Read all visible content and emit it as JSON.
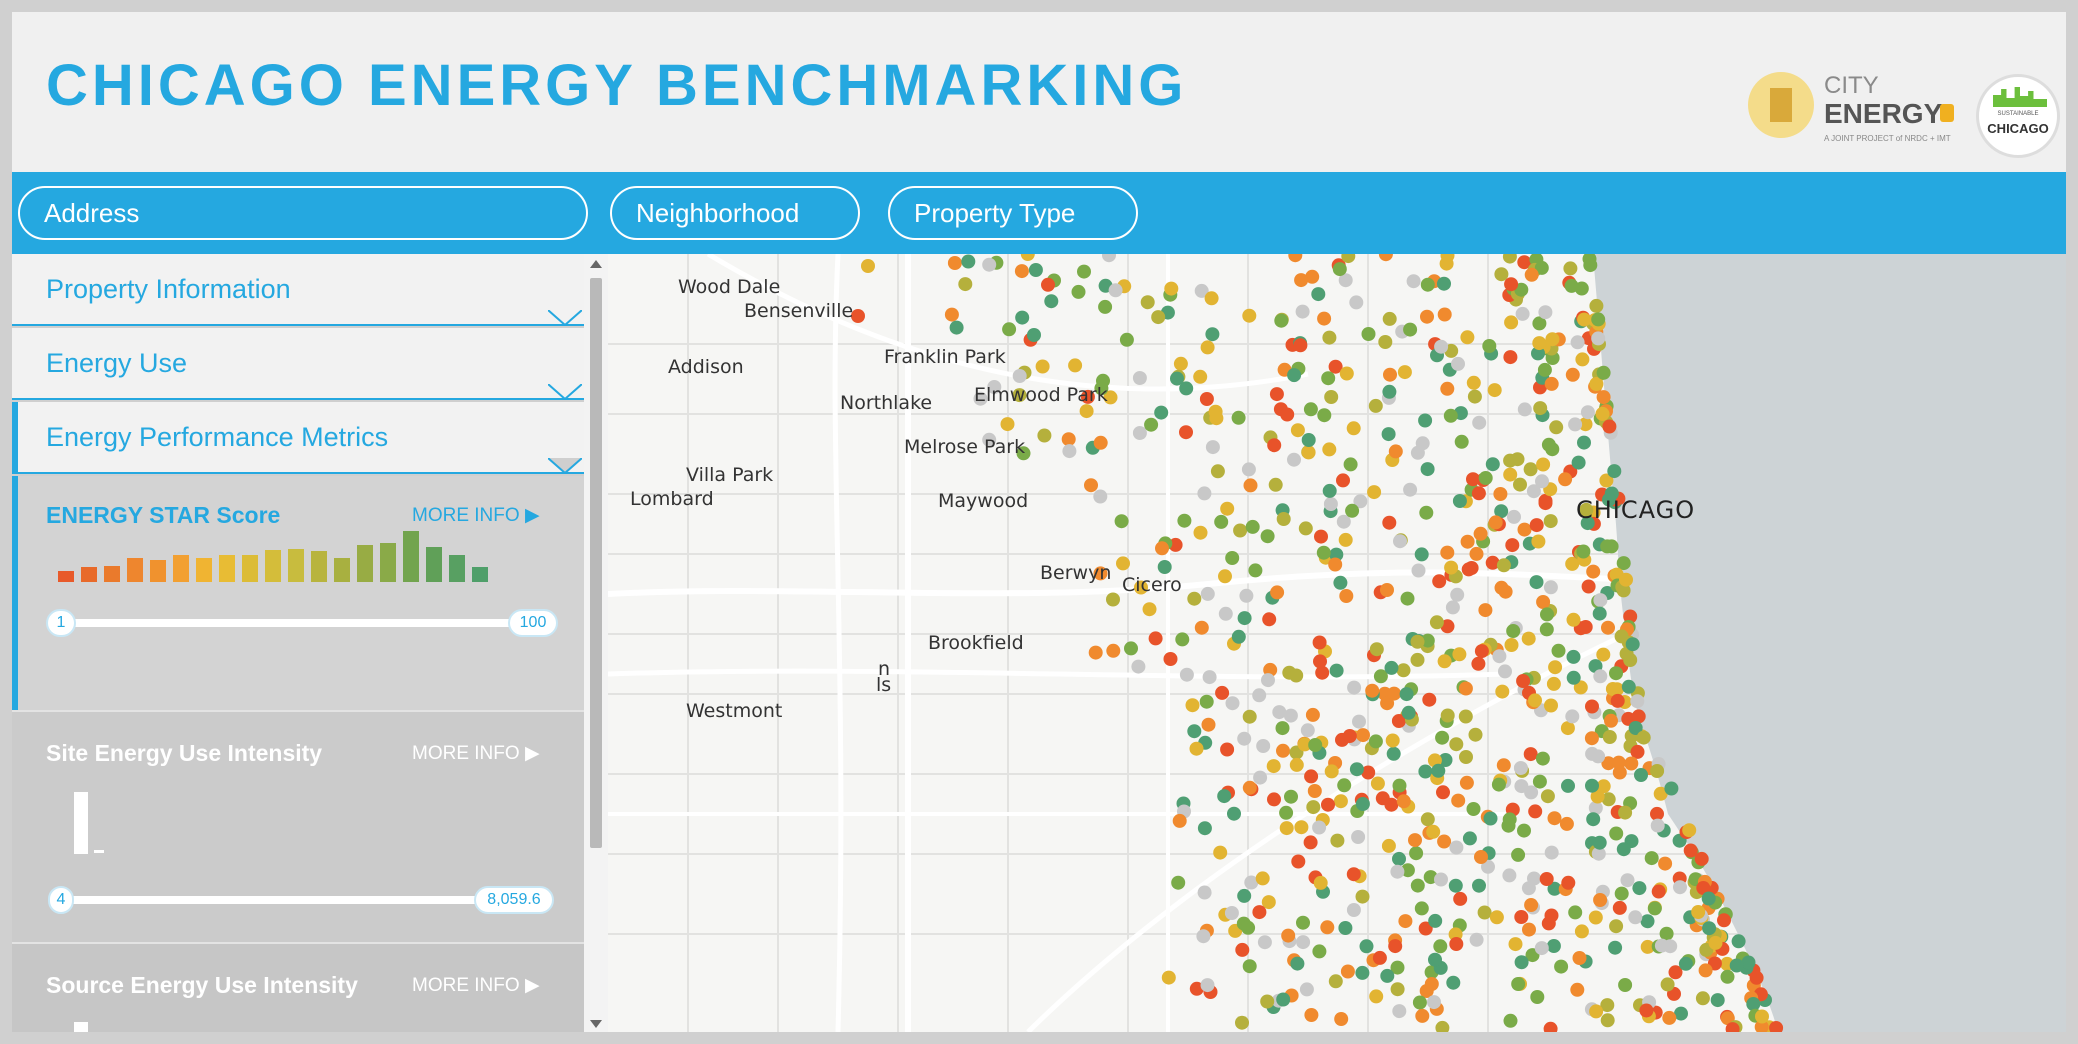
{
  "header": {
    "title": "CHICAGO ENERGY BENCHMARKING"
  },
  "logos": {
    "city_energy": {
      "line1": "CITY",
      "line2": "ENERGY",
      "sub": "A JOINT PROJECT of NRDC + IMT"
    },
    "sustainable_chicago": {
      "line1": "SUSTAINABLE",
      "line2": "CHICAGO"
    }
  },
  "nav": {
    "address": "Address",
    "neighborhood": "Neighborhood",
    "property_type": "Property Type"
  },
  "sidebar": {
    "sections": [
      "Property Information",
      "Energy Use",
      "Energy Performance Metrics"
    ],
    "more_info": "MORE INFO ▶",
    "energy_star": {
      "label": "ENERGY STAR Score",
      "min": "1",
      "max": "100",
      "histogram": [
        0.11,
        0.15,
        0.16,
        0.24,
        0.22,
        0.27,
        0.24,
        0.27,
        0.27,
        0.32,
        0.33,
        0.31,
        0.24,
        0.37,
        0.39,
        0.51,
        0.35,
        0.27,
        0.15
      ],
      "colors": [
        "#e85a2a",
        "#e86a2a",
        "#ea7a2c",
        "#ee862e",
        "#f0922e",
        "#f2a032",
        "#f0b432",
        "#e8bc34",
        "#dcbc36",
        "#d4bd3a",
        "#c8bc3e",
        "#b8b43e",
        "#a8b040",
        "#98ac44",
        "#8aaa48",
        "#72a44e",
        "#60a058",
        "#58a062",
        "#4f9f6a"
      ],
      "accent": "#25a8e0"
    },
    "site_eui": {
      "label": "Site Energy Use Intensity",
      "min": "4",
      "max": "8,059.6"
    },
    "source_eui": {
      "label": "Source Energy Use Intensity"
    }
  },
  "map": {
    "labels": {
      "wood_dale": "Wood Dale",
      "bensenville": "Bensenville",
      "addison": "Addison",
      "franklin_park": "Franklin Park",
      "northlake": "Northlake",
      "elmwood_park": "Elmwood Park",
      "melrose_park": "Melrose Park",
      "villa_park": "Villa Park",
      "lombard": "Lombard",
      "maywood": "Maywood",
      "chicago": "CHICAGO",
      "berwyn": "Berwyn",
      "cicero": "Cicero",
      "brookfield": "Brookfield",
      "westmont": "Westmont",
      "partial1": "n",
      "partial2": "ls"
    },
    "marker_colors": [
      "#e8532a",
      "#f08a2e",
      "#e2b432",
      "#b5b03c",
      "#7aab48",
      "#4f9f73",
      "#c8c8c8"
    ]
  }
}
